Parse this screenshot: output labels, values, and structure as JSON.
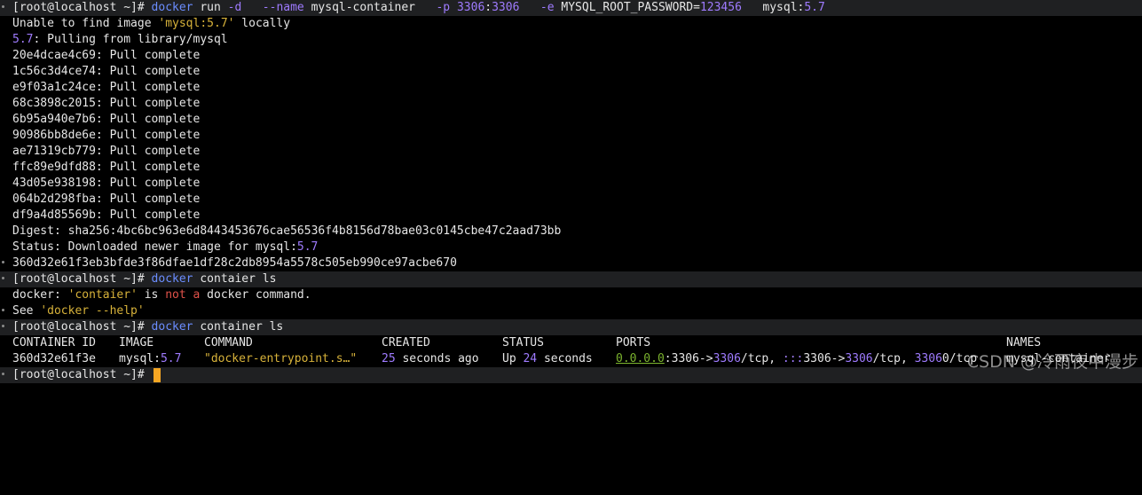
{
  "colors": {
    "background": "#000000",
    "command_band": "#1f2022",
    "text": "#e6e6e6",
    "keyword_blue": "#6b8dff",
    "number_purple": "#9f7bff",
    "string_yellow": "#d7b23a",
    "error_red": "#e0524a",
    "ip_green": "#7bb32e",
    "cursor": "#f5a623"
  },
  "prompt": "[root@localhost ~]#",
  "cmd1": {
    "docker": "docker",
    "run": " run ",
    "d": "-d",
    "s1": "   ",
    "name_flag": "--name",
    "name_val": " mysql-container   ",
    "p_flag": "-p",
    "port_a": " 3306",
    "colon": ":",
    "port_b": "3306",
    "s2": "   ",
    "e_flag": "-e",
    "env": " MYSQL_ROOT_PASSWORD=",
    "env_val": "123456",
    "image": "   mysql:",
    "tag": "5.7"
  },
  "unable": {
    "text1": "Unable to find image ",
    "quoted": "'mysql:5.7'",
    "text2": " locally"
  },
  "pulling": {
    "tag": "5.7",
    "rest": ": Pulling from library/mysql"
  },
  "layers": [
    "20e4dcae4c69",
    "1c56c3d4ce74",
    "e9f03a1c24ce",
    "68c3898c2015",
    "6b95a940e7b6",
    "90986bb8de6e",
    "ae71319cb779",
    "ffc89e9dfd88",
    "43d05e938198",
    "064b2d298fba",
    "df9a4d85569b"
  ],
  "pull_complete": ": Pull complete",
  "digest": {
    "label": "Digest",
    "colon": ": ",
    "algo": "sha256",
    "colon2": ":",
    "hash": "4bc6bc963e6d8443453676cae56536f4b8156d78bae03c0145cbe47c2aad73bb"
  },
  "status_line": {
    "text": "Status: Downloaded newer image for mysql:",
    "tag": "5.7"
  },
  "container_id_full": "360d32e61f3eb3bfde3f86dfae1df28c2db8954a5578c505eb990ce97acbe670",
  "cmd2": {
    "docker": "docker",
    "rest": " contaier ls"
  },
  "error_line": {
    "t1": "docker: ",
    "quoted": "'contaier'",
    "t2": " is ",
    "not_a": "not a",
    "t3": " docker command."
  },
  "see_help": {
    "t1": "See ",
    "quoted": "'docker --help'"
  },
  "cmd3": {
    "docker": "docker",
    "rest": " container ls"
  },
  "table": {
    "headers": {
      "container_id": "CONTAINER ID",
      "image": "IMAGE",
      "command": "COMMAND",
      "created": "CREATED",
      "status": "STATUS",
      "ports": "PORTS",
      "names": "NAMES"
    },
    "row": {
      "container_id": "360d32e61f3e",
      "image_name": "mysql:",
      "image_tag": "5.7",
      "command": "\"docker-entrypoint.s…\"",
      "created_num": "25",
      "created_rest": " seconds ago",
      "status_up": "Up ",
      "status_num": "24",
      "status_rest": " seconds",
      "ports_ip": "0.0.0.0",
      "ports_1a": ":3306->",
      "ports_1b": "3306",
      "ports_1c": "/tcp, ",
      "ports_ip6": ":::",
      "ports_2a": "3306->",
      "ports_2b": "3306",
      "ports_2c": "/tcp, ",
      "ports_3a": "3306",
      "ports_3b": "0/tcp",
      "names": "mysql-container"
    }
  },
  "watermark": "CSDN @冷雨夜中漫步"
}
